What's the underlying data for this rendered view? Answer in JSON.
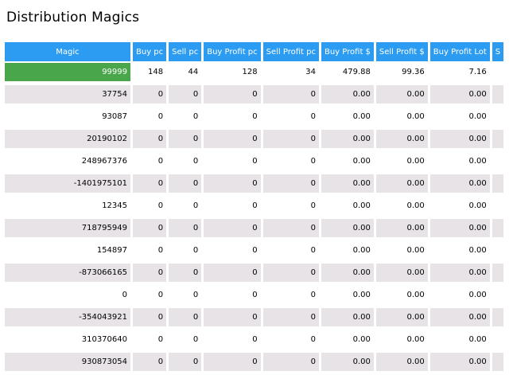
{
  "title": "Distribution Magics",
  "headers": [
    "Magic",
    "Buy pc",
    "Sell pc",
    "Buy Profit pc",
    "Sell Profit pc",
    "Buy Profit $",
    "Sell Profit $",
    "Buy Profit Lot",
    "S"
  ],
  "rows": [
    [
      "99999",
      "148",
      "44",
      "128",
      "34",
      "479.88",
      "99.36",
      "7.16",
      ""
    ],
    [
      "37754",
      "0",
      "0",
      "0",
      "0",
      "0.00",
      "0.00",
      "0.00",
      ""
    ],
    [
      "93087",
      "0",
      "0",
      "0",
      "0",
      "0.00",
      "0.00",
      "0.00",
      ""
    ],
    [
      "20190102",
      "0",
      "0",
      "0",
      "0",
      "0.00",
      "0.00",
      "0.00",
      ""
    ],
    [
      "248967376",
      "0",
      "0",
      "0",
      "0",
      "0.00",
      "0.00",
      "0.00",
      ""
    ],
    [
      "-1401975101",
      "0",
      "0",
      "0",
      "0",
      "0.00",
      "0.00",
      "0.00",
      ""
    ],
    [
      "12345",
      "0",
      "0",
      "0",
      "0",
      "0.00",
      "0.00",
      "0.00",
      ""
    ],
    [
      "718795949",
      "0",
      "0",
      "0",
      "0",
      "0.00",
      "0.00",
      "0.00",
      ""
    ],
    [
      "154897",
      "0",
      "0",
      "0",
      "0",
      "0.00",
      "0.00",
      "0.00",
      ""
    ],
    [
      "-873066165",
      "0",
      "0",
      "0",
      "0",
      "0.00",
      "0.00",
      "0.00",
      ""
    ],
    [
      "0",
      "0",
      "0",
      "0",
      "0",
      "0.00",
      "0.00",
      "0.00",
      ""
    ],
    [
      "-354043921",
      "0",
      "0",
      "0",
      "0",
      "0.00",
      "0.00",
      "0.00",
      ""
    ],
    [
      "310370640",
      "0",
      "0",
      "0",
      "0",
      "0.00",
      "0.00",
      "0.00",
      ""
    ],
    [
      "930873054",
      "0",
      "0",
      "0",
      "0",
      "0.00",
      "0.00",
      "0.00",
      ""
    ]
  ],
  "colors": {
    "header_bg": "#2c9cf2",
    "highlight_bg": "#4aa64a",
    "alt_row_bg": "#e8e3e6"
  }
}
